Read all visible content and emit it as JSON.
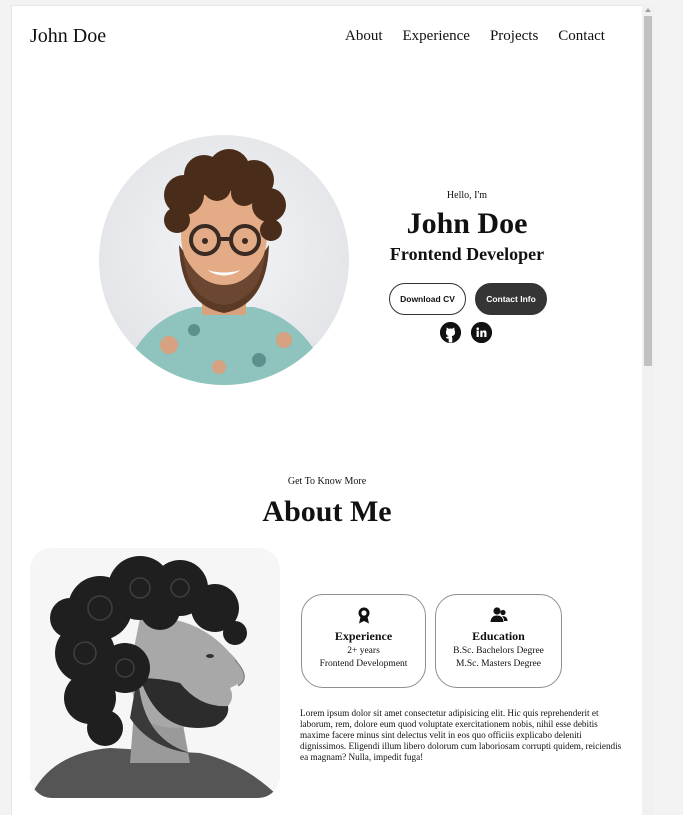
{
  "nav": {
    "logo": "John Doe",
    "links": [
      "About",
      "Experience",
      "Projects",
      "Contact"
    ]
  },
  "hero": {
    "greeting": "Hello, I'm",
    "name": "John Doe",
    "role": "Frontend Developer",
    "download_cv": "Download CV",
    "contact_info": "Contact Info",
    "socials": [
      "github-icon",
      "linkedin-icon"
    ]
  },
  "about": {
    "subtitle": "Get To Know More",
    "title": "About Me",
    "experience": {
      "title": "Experience",
      "lines": [
        "2+ years",
        "Frontend Development"
      ]
    },
    "education": {
      "title": "Education",
      "lines": [
        "B.Sc. Bachelors Degree",
        "M.Sc. Masters Degree"
      ]
    },
    "paragraph": "Lorem ipsum dolor sit amet consectetur adipisicing elit. Hic quis reprehenderit et laborum, rem, dolore eum quod voluptate exercitationem nobis, nihil esse debitis maxime facere minus sint delectus velit in eos quo officiis explicabo deleniti dignissimos. Eligendi illum libero dolorum cum laboriosam corrupti quidem, reiciendis ea magnam? Nulla, impedit fuga!"
  },
  "colors": {
    "dark_button": "#353535",
    "border": "#8f8f8f"
  }
}
